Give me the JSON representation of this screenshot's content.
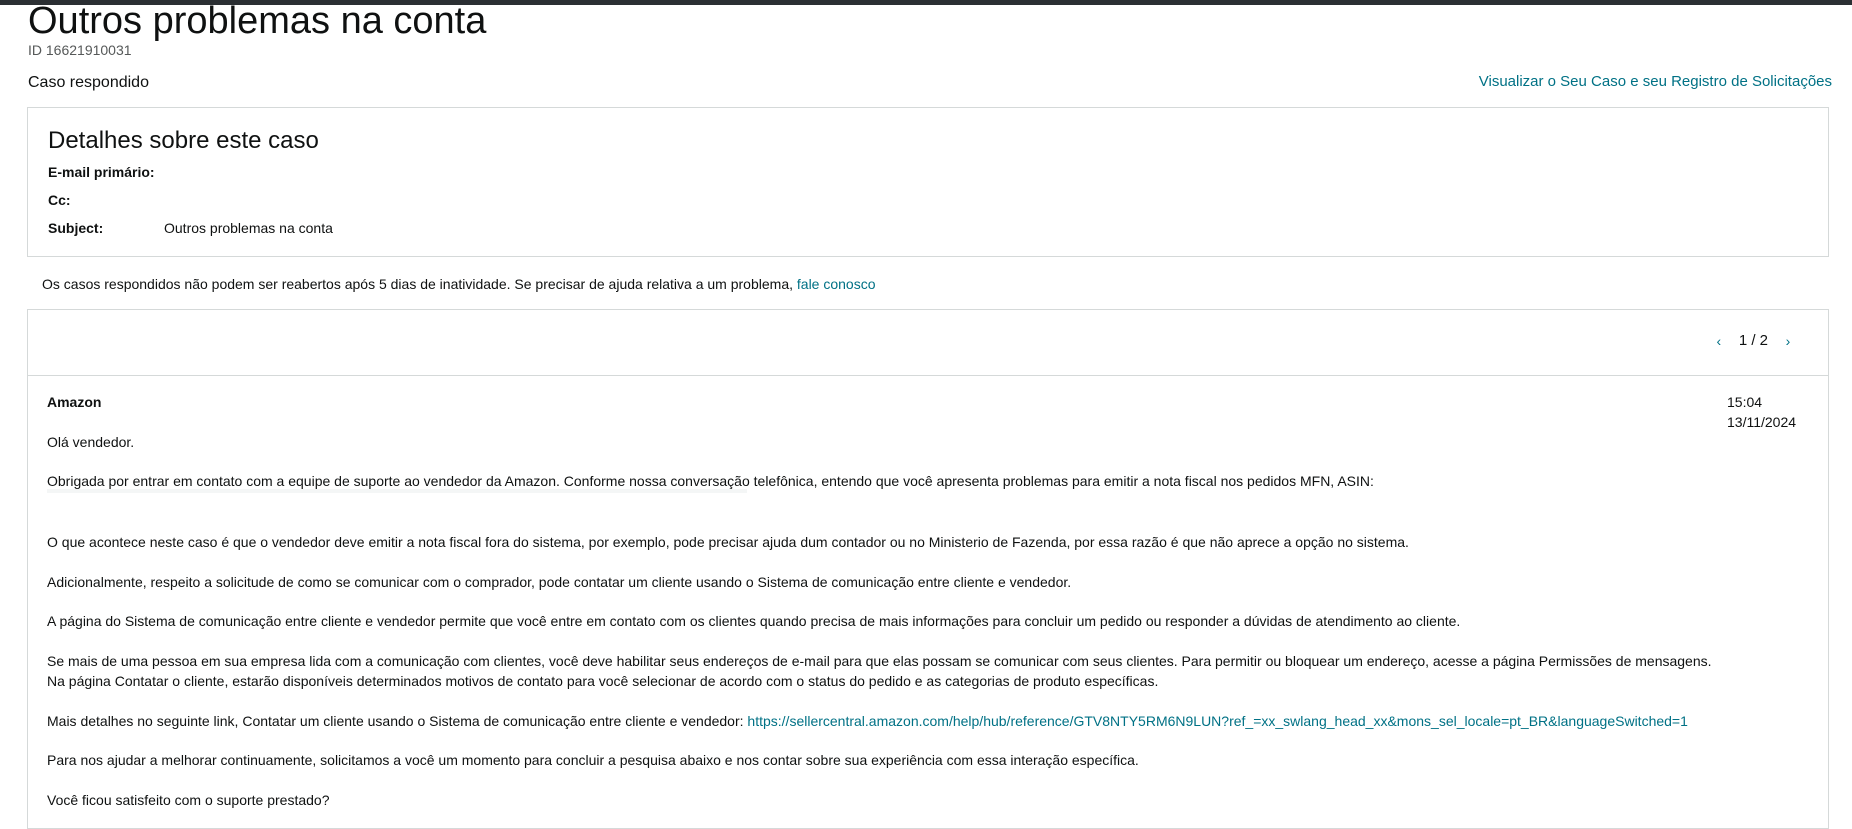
{
  "header": {
    "title": "Outros problemas na conta",
    "case_id": "ID 16621910031",
    "status": "Caso respondido",
    "view_link": "Visualizar o Seu Caso e seu Registro de Solicitações"
  },
  "details": {
    "title": "Detalhes sobre este caso",
    "rows": [
      {
        "label": "E-mail primário:",
        "value": ""
      },
      {
        "label": "Cc:",
        "value": ""
      },
      {
        "label": "Subject:",
        "value": "Outros problemas na conta"
      }
    ]
  },
  "notice": {
    "text": "Os casos respondidos não podem ser reabertos após 5 dias de inatividade. Se precisar de ajuda relativa a um problema, ",
    "link": "fale conosco"
  },
  "conversation": {
    "pager": "1 / 2",
    "icons": {
      "prev": "chevron-left-icon",
      "next": "chevron-right-icon"
    },
    "message": {
      "sender": "Amazon",
      "time": "15:04",
      "date": "13/11/2024",
      "paragraphs": [
        "Olá vendedor.",
        "Obrigada por entrar em contato com a equipe de suporte ao vendedor da Amazon. Conforme nossa conversação telefônica, entendo que você apresenta problemas para emitir a nota fiscal nos pedidos MFN, ASIN:",
        "O que acontece neste caso é que o vendedor deve emitir a nota fiscal fora do sistema, por exemplo, pode precisar ajuda dum contador ou no Ministerio de Fazenda, por essa razão é que não aprece a opção no sistema.",
        "Adicionalmente, respeito a solicitude de como se comunicar com o comprador, pode contatar um cliente usando o Sistema de comunicação entre cliente e vendedor.",
        "A página do Sistema de comunicação entre cliente e vendedor permite que você entre em contato com os clientes quando precisa de mais informações para concluir um pedido ou responder a dúvidas de atendimento ao cliente.",
        "Se mais de uma pessoa em sua empresa lida com a comunicação com clientes, você deve habilitar seus endereços de e-mail para que elas possam se comunicar com seus clientes. Para permitir ou bloquear um endereço, acesse a página Permissões de mensagens.",
        "Na página Contatar o cliente, estarão disponíveis determinados motivos de contato para você selecionar de acordo com o status do pedido e as categorias de produto específicas.",
        "Mais detalhes no seguinte link, Contatar um cliente usando o Sistema de comunicação entre cliente e vendedor:  ",
        "Para nos ajudar a melhorar continuamente, solicitamos a você um momento para concluir a pesquisa abaixo e nos contar sobre sua experiência com essa interação específica.",
        "Você ficou satisfeito com o suporte prestado?"
      ],
      "link_url": "https://sellercentral.amazon.com/help/hub/reference/GTV8NTY5RM6N9LUN?ref_=xx_swlang_head_xx&mons_sel_locale=pt_BR&languageSwitched=1"
    }
  },
  "colors": {
    "link": "#007185",
    "border": "#d5d9d9",
    "text": "#0f1111",
    "topbar": "#2b2f33"
  }
}
